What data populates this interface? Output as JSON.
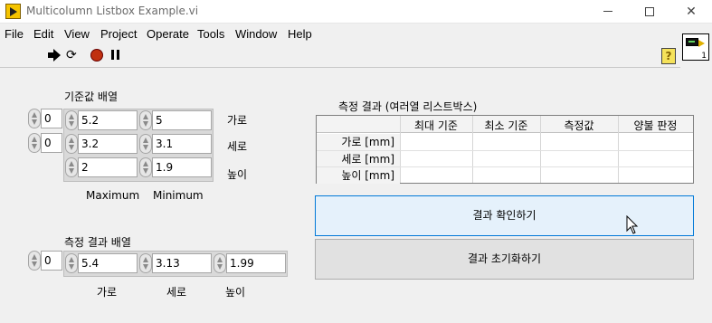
{
  "window": {
    "title": "Multicolumn Listbox Example.vi",
    "icon_number": "1"
  },
  "menu": [
    "File",
    "Edit",
    "View",
    "Project",
    "Operate",
    "Tools",
    "Window",
    "Help"
  ],
  "toolbar": {
    "run_icon": "run-arrow-icon",
    "run_continuous_icon": "run-continuously-icon",
    "abort_icon": "abort-icon",
    "pause_icon": "pause-icon",
    "help_icon": "context-help-icon",
    "help_glyph": "?"
  },
  "reference_array": {
    "label": "기준값 배열",
    "index_top": "0",
    "index_bottom": "0",
    "max_values": [
      "5.2",
      "3.2",
      "2"
    ],
    "min_values": [
      "5",
      "3.1",
      "1.9"
    ],
    "row_labels": [
      "가로",
      "세로",
      "높이"
    ],
    "col_labels": [
      "Maximum",
      "Minimum"
    ]
  },
  "measurement_array": {
    "label": "측정 결과 배열",
    "index": "0",
    "values": [
      "5.4",
      "3.13",
      "1.99"
    ],
    "col_labels": [
      "가로",
      "세로",
      "높이"
    ]
  },
  "listbox": {
    "label": "측정 결과 (여러열 리스트박스)",
    "columns": [
      "최대 기준",
      "최소 기준",
      "측정값",
      "양불 판정"
    ],
    "rows": [
      "가로 [mm]",
      "세로 [mm]",
      "높이 [mm]"
    ]
  },
  "buttons": {
    "check": "결과 확인하기",
    "reset": "결과 초기화하기"
  },
  "colors": {
    "panel_bg": "#f0f0f0",
    "focus_border": "#0078d7",
    "focus_bg": "#e5f1fb"
  }
}
